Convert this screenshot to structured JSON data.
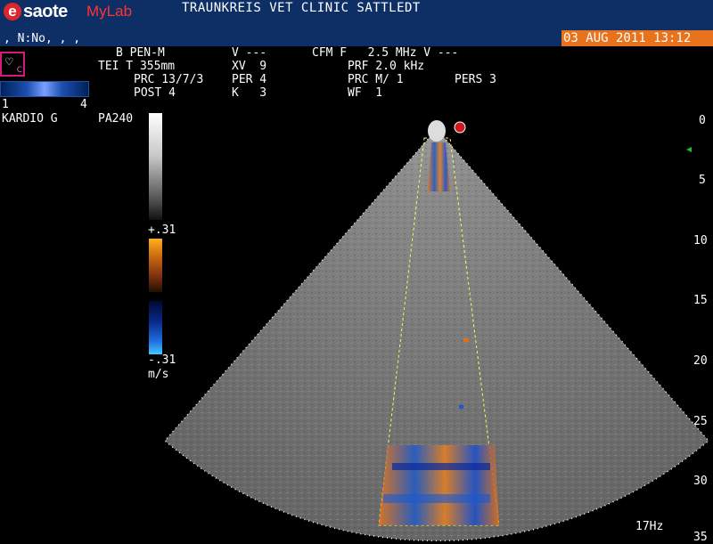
{
  "header": {
    "logo_e": "e",
    "logo_brand": "saote",
    "logo_my": "My",
    "logo_lab": "Lab",
    "clinic_name": "TRAUNKREIS VET CLINIC SATTLEDT",
    "patient_line": ", N:No, , ,",
    "datetime": "03 AUG 2011 13:12"
  },
  "params": {
    "b_mode": "B PEN-M",
    "v1": "V ---",
    "cfm": "CFM F   2.5 MHz V ---",
    "tei": "TEI T 355mm",
    "xv": "XV  9",
    "prf": "PRF 2.0 kHz",
    "prc1": "PRC 13/7/3",
    "per": "PER 4",
    "prc2": "PRC M/ 1",
    "pers": "PERS 3",
    "post": "POST 4",
    "k": "K   3",
    "wf": "WF  1"
  },
  "sidebar": {
    "map_min": "1",
    "map_max": "4",
    "preset": "KARDIO G",
    "probe": "PA240",
    "vel_pos": "+.31",
    "vel_neg": "-.31",
    "vel_unit": "m/s"
  },
  "depth_scale": [
    "0",
    "5",
    "10",
    "15",
    "20",
    "25",
    "30",
    "35"
  ],
  "frame_rate": "17Hz",
  "colors": {
    "header_bg": "#0e2e66",
    "date_bg": "#e8731c",
    "brand_red": "#d9272e",
    "sector_gray": "#7a7a7a"
  },
  "icons": {
    "mode_icon": "heart-mode-icon",
    "probe_marker": "probe-marker-icon",
    "focus_marker": "focus-triangle-icon"
  }
}
